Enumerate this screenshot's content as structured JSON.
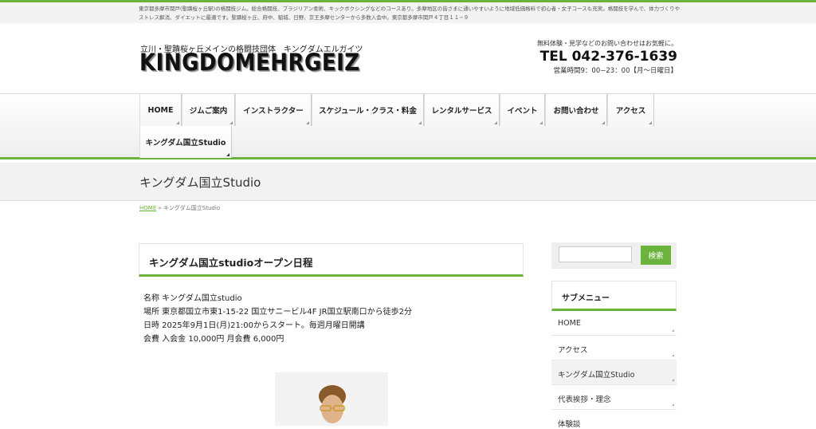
{
  "topbar": {
    "text": "東京都多摩市関戸(聖蹟桜ヶ丘駅)の格闘技ジム。総合格闘技、ブラジリアン柔術、キックボクシングなどのコースあり。多摩地区の皆さまに通いやすいように地域低価格料で初心者・女子コースも充実。格闘技を学んで、体力づくりやストレス解消、ダイエットに最適です。聖蹟桜ヶ丘、府中、稲城、日野、京王多摩センターから多数入会中。東京都多摩市関戸４丁目１１−９"
  },
  "header": {
    "tagline": "立川・聖蹟桜ヶ丘メインの格闘技団体　キングダムエルガイツ",
    "logo": "KINGDOMEHRGEIZ",
    "contact_note": "無料体験・見学などのお問い合わせはお気軽に。",
    "tel": "TEL 042-376-1639",
    "hours": "営業時間9：00−23：00【月〜日曜日】"
  },
  "nav": {
    "items": [
      {
        "label": "HOME"
      },
      {
        "label": "ジムご案内"
      },
      {
        "label": "インストラクター"
      },
      {
        "label": "スケジュール・クラス・料金"
      },
      {
        "label": "レンタルサービス"
      },
      {
        "label": "イベント"
      },
      {
        "label": "お問い合わせ"
      },
      {
        "label": "アクセス"
      },
      {
        "label": "キングダム国立Studio"
      }
    ]
  },
  "page": {
    "title": "キングダム国立Studio",
    "breadcrumb": {
      "home": "HOME",
      "separator": "»",
      "current": "キングダム国立Studio"
    }
  },
  "post": {
    "title": "キングダム国立studioオープン日程",
    "lines": [
      "名称 キングダム国立studio",
      "場所 東京都国立市東1-15-22 国立サニービル4F JR国立駅南口から徒歩2分",
      "日時 2025年9月1日(月)21:00からスタート。毎週月曜日開講",
      "会費 入会金 10,000円 月会費 6,000円"
    ]
  },
  "sidebar": {
    "search_button": "検索",
    "search_value": "",
    "submenu_title": "サブメニュー",
    "submenu_items": [
      {
        "label": "HOME"
      },
      {
        "label": "アクセス"
      },
      {
        "label": "キングダム国立Studio"
      },
      {
        "label": "代表挨拶・理念"
      },
      {
        "label": "体験談"
      }
    ]
  },
  "colors": {
    "accent": "#6cb33e"
  }
}
